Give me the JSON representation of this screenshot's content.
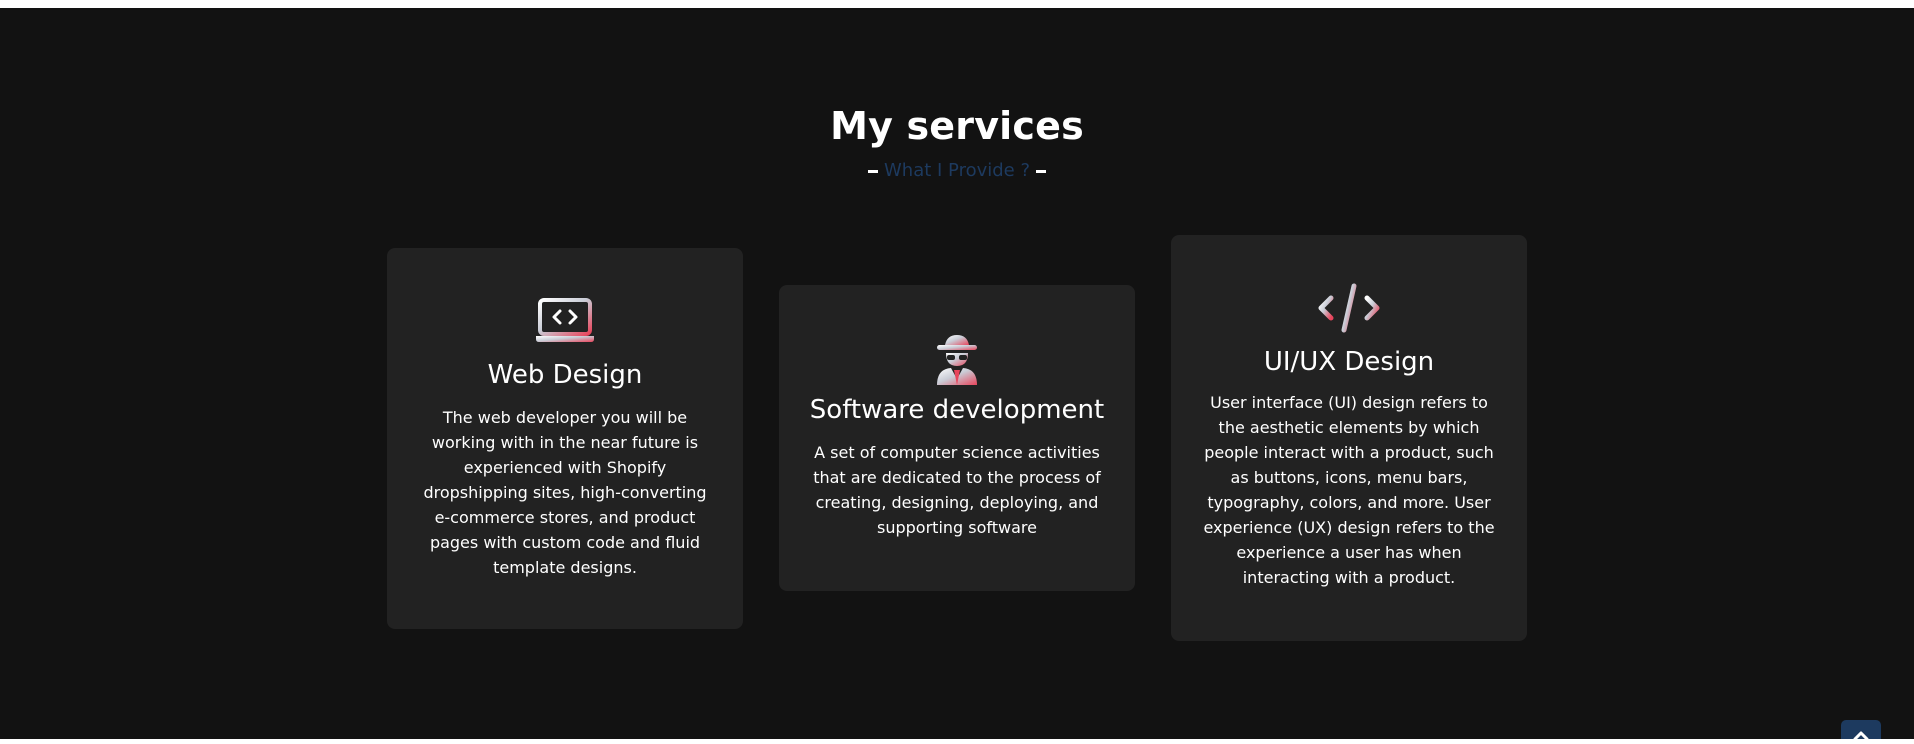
{
  "section": {
    "title": "My services",
    "subtitle": "What I Provide ?"
  },
  "colors": {
    "background": "#121212",
    "card_background": "#222222",
    "subtitle_accent": "#1d3a5f",
    "icon_gradient_start": "#ffffff",
    "icon_gradient_end": "#e8455c"
  },
  "services": [
    {
      "icon": "laptop-code-icon",
      "title": "Web Design",
      "text": "The web developer you will be working with in the near future is experienced with Shopify dropshipping sites, high-converting e-commerce stores, and product pages with custom code and fluid template designs."
    },
    {
      "icon": "user-secret-icon",
      "title": "Software development",
      "text": "A set of computer science activities that are dedicated to the process of creating, designing, deploying, and supporting software"
    },
    {
      "icon": "code-icon",
      "title": "UI/UX Design",
      "text": "User interface (UI) design refers to the aesthetic elements by which people interact with a product, such as buttons, icons, menu bars, typography, colors, and more. User experience (UX) design refers to the experience a user has when interacting with a product."
    }
  ],
  "scroll_top_icon": "chevron-up-icon"
}
